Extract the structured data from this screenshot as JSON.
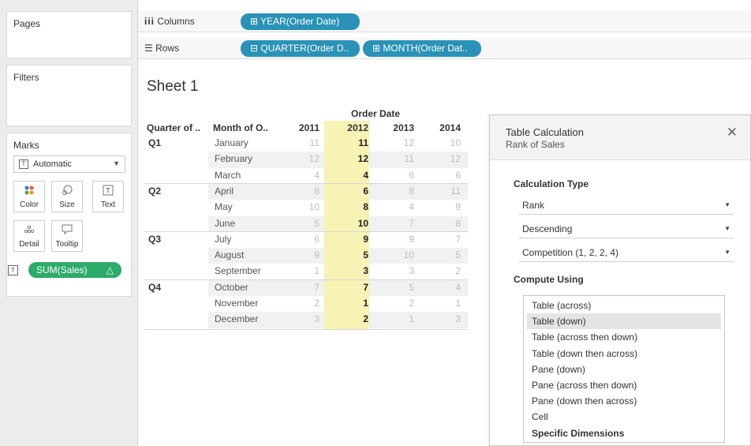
{
  "left_panels": {
    "pages_title": "Pages",
    "filters_title": "Filters",
    "marks_title": "Marks",
    "marks_type": "Automatic",
    "mark_buttons": [
      {
        "label": "Color",
        "icon": "color-icon"
      },
      {
        "label": "Size",
        "icon": "size-icon"
      },
      {
        "label": "Text",
        "icon": "text-icon"
      },
      {
        "label": "Detail",
        "icon": "detail-icon"
      },
      {
        "label": "Tooltip",
        "icon": "tooltip-icon"
      }
    ],
    "measure_pill": "SUM(Sales)",
    "measure_pill_delta": "△"
  },
  "shelves": {
    "columns_label": "Columns",
    "rows_label": "Rows",
    "columns_pills": [
      "⊞ YEAR(Order Date)"
    ],
    "rows_pills": [
      "⊟ QUARTER(Order D..",
      "⊞ MONTH(Order Dat.."
    ]
  },
  "sheet": {
    "title": "Sheet 1",
    "order_date_header": "Order Date",
    "col_quarter": "Quarter of ..",
    "col_month": "Month of O..",
    "years": [
      "2011",
      "2012",
      "2013",
      "2014"
    ],
    "highlight_year": "2012",
    "quarters": [
      "Q1",
      "Q2",
      "Q3",
      "Q4"
    ],
    "rows": [
      {
        "month": "January",
        "values": [
          "11",
          "11",
          "12",
          "10"
        ]
      },
      {
        "month": "February",
        "values": [
          "12",
          "12",
          "11",
          "12"
        ]
      },
      {
        "month": "March",
        "values": [
          "4",
          "4",
          "6",
          "6"
        ]
      },
      {
        "month": "April",
        "values": [
          "8",
          "6",
          "8",
          "11"
        ]
      },
      {
        "month": "May",
        "values": [
          "10",
          "8",
          "4",
          "9"
        ]
      },
      {
        "month": "June",
        "values": [
          "5",
          "10",
          "7",
          "8"
        ]
      },
      {
        "month": "July",
        "values": [
          "6",
          "9",
          "9",
          "7"
        ]
      },
      {
        "month": "August",
        "values": [
          "9",
          "5",
          "10",
          "5"
        ]
      },
      {
        "month": "September",
        "values": [
          "1",
          "3",
          "3",
          "2"
        ]
      },
      {
        "month": "October",
        "values": [
          "7",
          "7",
          "5",
          "4"
        ]
      },
      {
        "month": "November",
        "values": [
          "2",
          "1",
          "2",
          "1"
        ]
      },
      {
        "month": "December",
        "values": [
          "3",
          "2",
          "1",
          "3"
        ]
      }
    ]
  },
  "table_calc": {
    "title": "Table Calculation",
    "subtitle": "Rank of Sales",
    "calc_type_label": "Calculation Type",
    "calc_type": "Rank",
    "order": "Descending",
    "rank_style": "Competition (1, 2, 2, 4)",
    "compute_using_label": "Compute Using",
    "compute_options": [
      "Table (across)",
      "Table (down)",
      "Table (across then down)",
      "Table (down then across)",
      "Pane (down)",
      "Pane (across then down)",
      "Pane (down then across)",
      "Cell",
      "Specific Dimensions"
    ],
    "selected_option": "Table (down)"
  },
  "colors": {
    "columns_pill": "#2a92b6",
    "measure_pill": "#2eaa6b",
    "highlight": "#f6f3b4"
  }
}
